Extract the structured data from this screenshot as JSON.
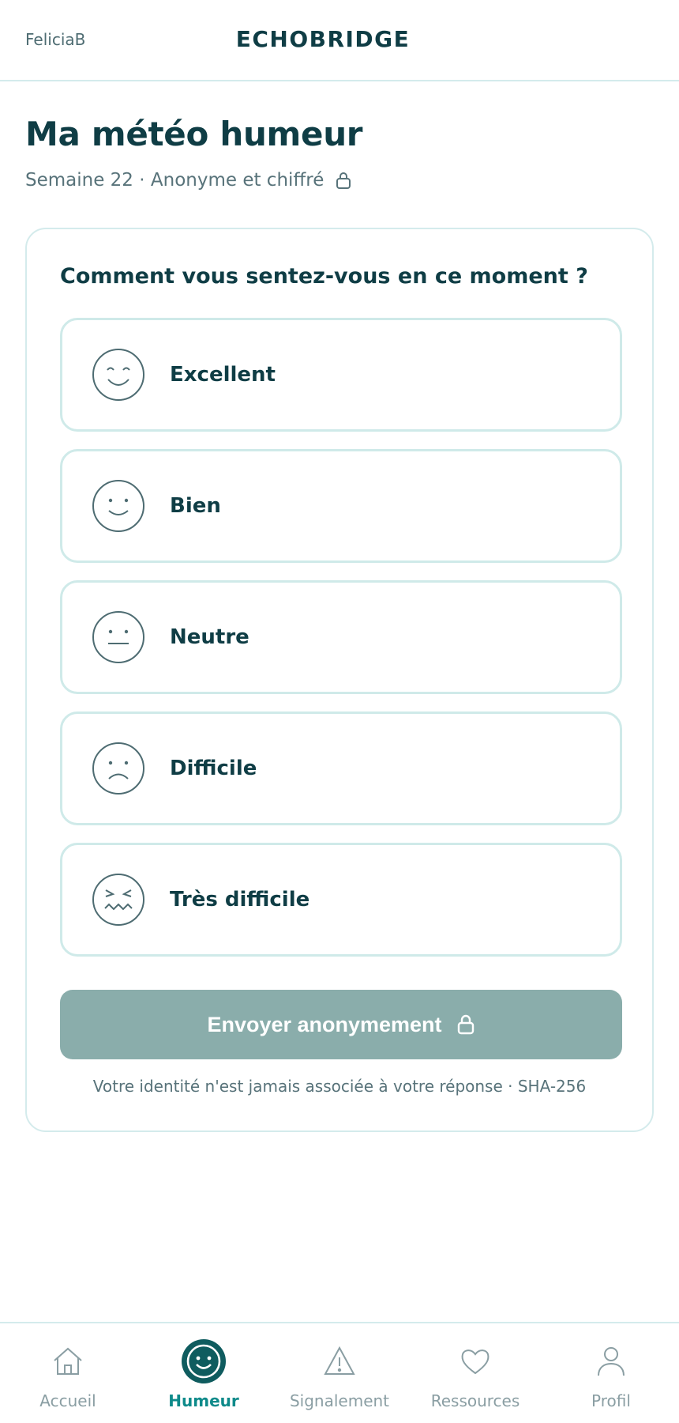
{
  "header": {
    "user": "FeliciaB",
    "brand": "ECHOBRIDGE"
  },
  "page": {
    "title": "Ma météo humeur",
    "subtitle": "Semaine 22 · Anonyme et chiffré",
    "subtitle_icon": "lock-icon"
  },
  "card": {
    "question": "Comment vous sentez-vous en ce moment ?",
    "options": [
      {
        "label": "Excellent",
        "icon": "grin-face-icon"
      },
      {
        "label": "Bien",
        "icon": "smile-face-icon"
      },
      {
        "label": "Neutre",
        "icon": "neutral-face-icon"
      },
      {
        "label": "Difficile",
        "icon": "frown-face-icon"
      },
      {
        "label": "Très difficile",
        "icon": "distressed-face-icon"
      }
    ],
    "submit_label": "Envoyer anonymement",
    "submit_icon": "lock-icon",
    "footnote": "Votre identité n'est jamais associée à votre réponse · SHA-256"
  },
  "tabbar": {
    "tabs": [
      {
        "label": "Accueil",
        "icon": "home-icon",
        "active": false
      },
      {
        "label": "Humeur",
        "icon": "mood-icon",
        "active": true
      },
      {
        "label": "Signalement",
        "icon": "warning-icon",
        "active": false
      },
      {
        "label": "Ressources",
        "icon": "heart-icon",
        "active": false
      },
      {
        "label": "Profil",
        "icon": "user-icon",
        "active": false
      }
    ]
  },
  "colors": {
    "primary": "#0f3d45",
    "accent": "#0e8a8a",
    "border": "#cfeae9",
    "submit_disabled": "#8aadab",
    "muted_text": "#58737a"
  }
}
